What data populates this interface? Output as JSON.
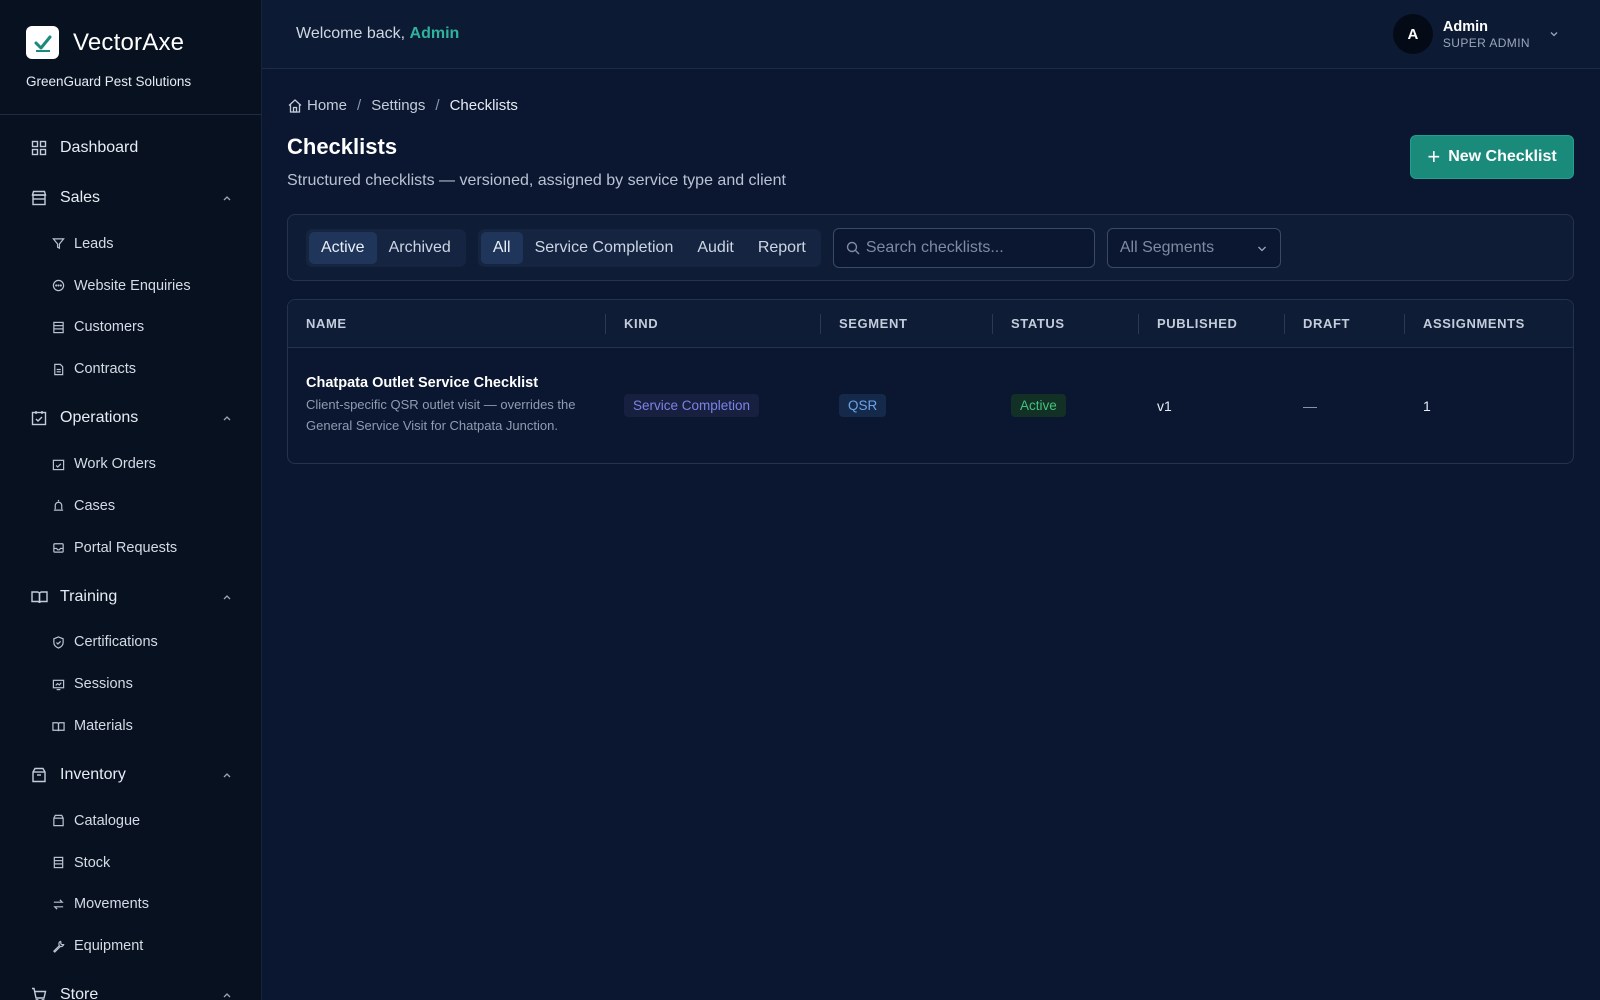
{
  "brand": {
    "name": "VectorAxe",
    "org": "GreenGuard Pest Solutions"
  },
  "sidebar": {
    "dashboard": "Dashboard",
    "groups": [
      {
        "label": "Sales",
        "items": [
          "Leads",
          "Website Enquiries",
          "Customers",
          "Contracts"
        ]
      },
      {
        "label": "Operations",
        "items": [
          "Work Orders",
          "Cases",
          "Portal Requests"
        ]
      },
      {
        "label": "Training",
        "items": [
          "Certifications",
          "Sessions",
          "Materials"
        ]
      },
      {
        "label": "Inventory",
        "items": [
          "Catalogue",
          "Stock",
          "Movements",
          "Equipment"
        ]
      },
      {
        "label": "Store",
        "items": []
      }
    ]
  },
  "topbar": {
    "welcome": "Welcome back,",
    "welcome_name": "Admin"
  },
  "user": {
    "initial": "A",
    "name": "Admin",
    "role": "SUPER ADMIN"
  },
  "breadcrumb": {
    "home": "Home",
    "settings": "Settings",
    "current": "Checklists"
  },
  "page": {
    "title": "Checklists",
    "subtitle": "Structured checklists — versioned, assigned by service type and client",
    "new_button": "New Checklist"
  },
  "filters": {
    "state_tabs": [
      "Active",
      "Archived"
    ],
    "kind_tabs": [
      "All",
      "Service Completion",
      "Audit",
      "Report"
    ],
    "search_placeholder": "Search checklists...",
    "segment_select": "All Segments"
  },
  "table": {
    "headers": [
      "NAME",
      "KIND",
      "SEGMENT",
      "STATUS",
      "PUBLISHED",
      "DRAFT",
      "ASSIGNMENTS"
    ],
    "rows": [
      {
        "name": "Chatpata Outlet Service Checklist",
        "description": "Client-specific QSR outlet visit — overrides the General Service Visit for Chatpata Junction.",
        "kind": "Service Completion",
        "segment": "QSR",
        "status": "Active",
        "published": "v1",
        "draft": "—",
        "assignments": "1"
      }
    ]
  },
  "colors": {
    "accent": "#1a8a7b",
    "background": "#0b1730",
    "sidebar": "#08111f"
  }
}
